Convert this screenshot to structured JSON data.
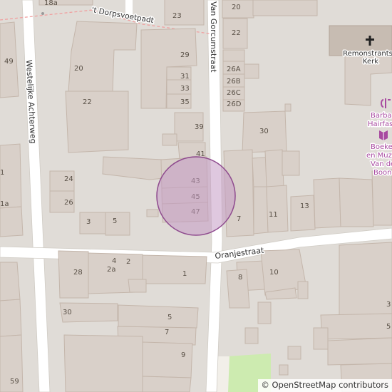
{
  "map": {
    "marker_fill": "#c49ac4",
    "marker_stroke": "#8e4a8e",
    "building_fill": "#d9d0c9",
    "building_stroke": "#c4b6ab",
    "road_fill": "#ffffff",
    "background": "#e0dcd7",
    "green_area": "#cdebb0"
  },
  "roads": {
    "van_gorcumstraat": "Van Gorcumstraat",
    "westelijke_achterweg": "Westelijke Achterweg",
    "oranjestraat": "Oranjestraat",
    "dorpsvoetpad": "'t Dorpsvoetpadt"
  },
  "church": {
    "name_line1": "Remonstrants",
    "name_line2": "Kerk",
    "icon": "cross-icon"
  },
  "poi": {
    "hair_line1": "Barba",
    "hair_line2": "Hairfas",
    "books_line1": "Boeke",
    "books_line2": "en Muzi",
    "books_line3": "Van de",
    "books_line4": "Boon",
    "hair_icon": "hairdresser-icon",
    "books_icon": "book-icon"
  },
  "house_numbers": {
    "n18a": "18a",
    "n20a": "20",
    "n23": "23",
    "n20b": "20",
    "n22": "22",
    "n49": "49",
    "n29": "29",
    "n31": "31",
    "n33": "33",
    "n35": "35",
    "n26a": "26A",
    "n26b": "26B",
    "n26c": "26C",
    "n26d": "26D",
    "n20c": "20",
    "n22b": "22",
    "n39": "39",
    "n30a": "30",
    "n41": "41",
    "n43": "43",
    "n45": "45",
    "n47": "47",
    "n24": "24",
    "n26": "26",
    "n3": "3",
    "n5a": "5",
    "n7a": "7",
    "n11": "11",
    "n13": "13",
    "n1a": "1",
    "n1b": "1a",
    "n28": "28",
    "n4": "4",
    "n2a": "2a",
    "n2": "2",
    "n1c": "1",
    "n8": "8",
    "n10": "10",
    "n30b": "30",
    "n5b": "5",
    "n7b": "7",
    "n9": "9",
    "n59": "59",
    "n3b": "3",
    "n5c": "5"
  },
  "attribution": {
    "copyright": "© ",
    "text": "OpenStreetMap contributors"
  }
}
